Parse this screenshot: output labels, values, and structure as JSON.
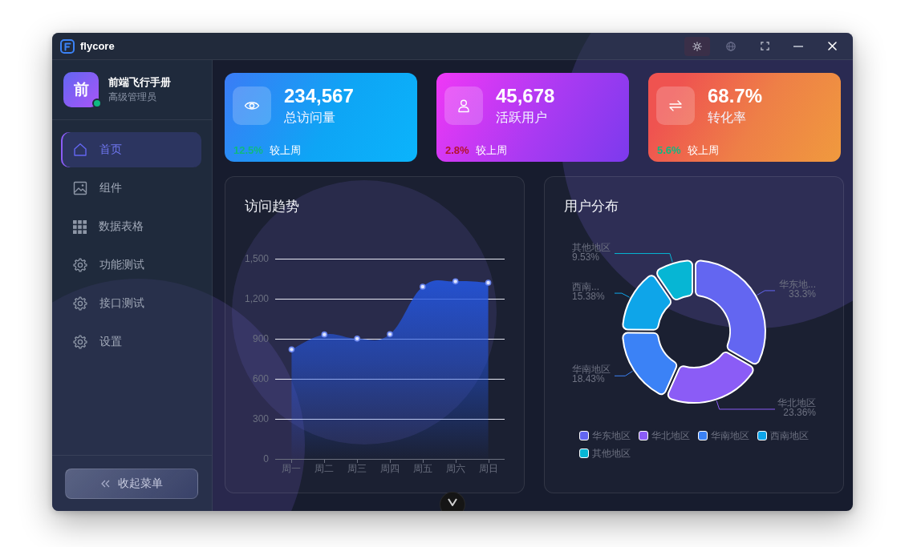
{
  "window": {
    "app_name": "flycore",
    "controls": [
      {
        "kind": "theme",
        "active": true
      },
      {
        "kind": "language",
        "active": false
      },
      {
        "kind": "fullscreen",
        "active": false
      },
      {
        "kind": "minimize",
        "active": false
      },
      {
        "kind": "close",
        "active": false
      }
    ]
  },
  "profile": {
    "avatar_text": "前",
    "name": "前端飞行手册",
    "role": "高级管理员",
    "online": true
  },
  "nav": [
    {
      "kind": "home",
      "label": "首页",
      "selected": true
    },
    {
      "kind": "image",
      "label": "组件",
      "selected": false
    },
    {
      "kind": "grid",
      "label": "数据表格",
      "selected": false
    },
    {
      "kind": "gear",
      "label": "功能测试",
      "selected": false
    },
    {
      "kind": "gear",
      "label": "接口测试",
      "selected": false
    },
    {
      "kind": "gear",
      "label": "设置",
      "selected": false
    }
  ],
  "collapse_button": {
    "label": "收起菜单"
  },
  "stats": [
    {
      "kind": "visits",
      "value": "234,567",
      "label": "总访问量",
      "change": "12.5%",
      "positive": true,
      "compare": "较上周"
    },
    {
      "kind": "users",
      "value": "45,678",
      "label": "活跃用户",
      "change": "2.8%",
      "positive": false,
      "compare": "较上周"
    },
    {
      "kind": "conversion",
      "value": "68.7%",
      "label": "转化率",
      "change": "5.6%",
      "positive": true,
      "compare": "较上周"
    }
  ],
  "visit_trend": {
    "chart_data": {
      "type": "area",
      "title": "访问趋势",
      "categories": [
        "周一",
        "周二",
        "周三",
        "周四",
        "周五",
        "周六",
        "周日"
      ],
      "series": [
        {
          "color": "#2456e0",
          "values": [
            820,
            932,
            901,
            934,
            1290,
            1330,
            1320
          ]
        }
      ],
      "ylim": [
        0,
        1500
      ],
      "yticks": [
        0,
        300,
        600,
        900,
        {
          "value": 1200,
          "label": "1,200"
        },
        {
          "value": 1500,
          "label": "1,500"
        }
      ],
      "grid": true
    }
  },
  "user_distribution": {
    "chart_data": {
      "type": "donut",
      "title": "用户分布",
      "categories": [
        "华东地区",
        "华北地区",
        "华南地区",
        "西南地区",
        "其他地区"
      ],
      "values": [
        33.3,
        23.36,
        18.43,
        15.38,
        9.53
      ],
      "value_labels": [
        {
          "name": "华东地...",
          "value": "33.3%"
        },
        {
          "name": "华北地区",
          "value": "23.36%"
        },
        {
          "name": "华南地区",
          "value": "18.43%"
        },
        {
          "name": "西南...",
          "value": "15.38%"
        },
        {
          "name": "其他地区",
          "value": "9.53%"
        }
      ]
    },
    "legend": [
      {
        "color": "#6366f1"
      },
      {
        "color": "#8b5cf6"
      },
      {
        "color": "#3b82f6"
      },
      {
        "color": "#0ea5e9"
      },
      {
        "color": "#06b6d4"
      }
    ]
  }
}
